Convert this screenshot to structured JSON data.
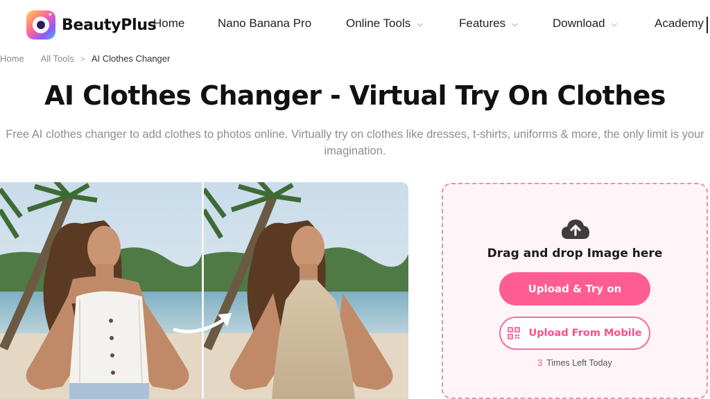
{
  "brand": {
    "name": "BeautyPlus"
  },
  "nav": {
    "items": [
      {
        "label": "Home",
        "has_dropdown": false
      },
      {
        "label": "Nano Banana Pro",
        "has_dropdown": false
      },
      {
        "label": "Online Tools",
        "has_dropdown": true
      },
      {
        "label": "Features",
        "has_dropdown": true
      },
      {
        "label": "Download",
        "has_dropdown": true
      },
      {
        "label": "Academy",
        "has_dropdown": false
      }
    ]
  },
  "breadcrumb": {
    "items": [
      "Home",
      "All Tools",
      "AI Clothes Changer"
    ],
    "separator": ">"
  },
  "hero": {
    "title": "AI Clothes Changer - Virtual Try On Clothes",
    "subtitle": "Free AI clothes changer to add clothes to photos online. Virtually try on clothes like dresses, t-shirts, uniforms & more, the only limit is your imagination."
  },
  "upload": {
    "icon": "cloud-upload-icon",
    "prompt": "Drag and drop Image here",
    "primary_button": "Upload & Try on",
    "secondary_button": "Upload From Mobile",
    "secondary_icon": "qr-code-icon",
    "times_left_count": "3",
    "times_left_label": "Times Left Today"
  },
  "colors": {
    "accent": "#ff5c93",
    "upload_border": "#f08bb0",
    "upload_background": "#fff5f8",
    "subtitle_text": "#8e8e8e"
  }
}
